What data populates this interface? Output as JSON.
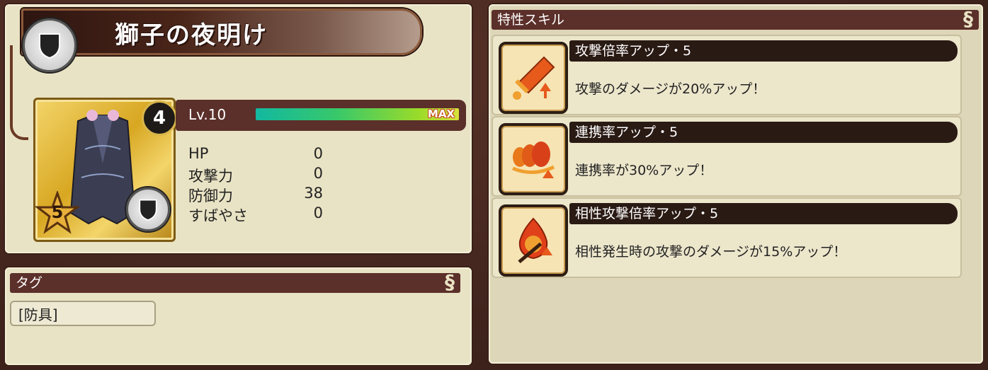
{
  "equipment": {
    "name": "獅子の夜明け",
    "level_label": "Lv.10",
    "level_progress": 1.0,
    "max_label": "MAX",
    "upgrade_level": "4",
    "rarity": "5",
    "type_icon": "shield-icon"
  },
  "stats": [
    {
      "name": "HP",
      "value": "0"
    },
    {
      "name": "攻撃力",
      "value": "0"
    },
    {
      "name": "防御力",
      "value": "38"
    },
    {
      "name": "すばやさ",
      "value": "0"
    }
  ],
  "tags": {
    "header": "タグ",
    "items": [
      "[防具]"
    ]
  },
  "skills": {
    "header": "特性スキル",
    "items": [
      {
        "name": "攻撃倍率アップ・5",
        "description": "攻撃のダメージが20%アップ！",
        "icon": "sword-up-icon"
      },
      {
        "name": "連携率アップ・5",
        "description": "連携率が30%アップ！",
        "icon": "chain-up-icon"
      },
      {
        "name": "相性攻撃倍率アップ・5",
        "description": "相性発生時の攻撃のダメージが15%アップ！",
        "icon": "affinity-sword-icon"
      }
    ]
  },
  "colors": {
    "panel": "#e9e3c5",
    "header": "#5b2f2a",
    "skill_name_bg": "#2a1a14",
    "card_gold": "#d8a722"
  }
}
